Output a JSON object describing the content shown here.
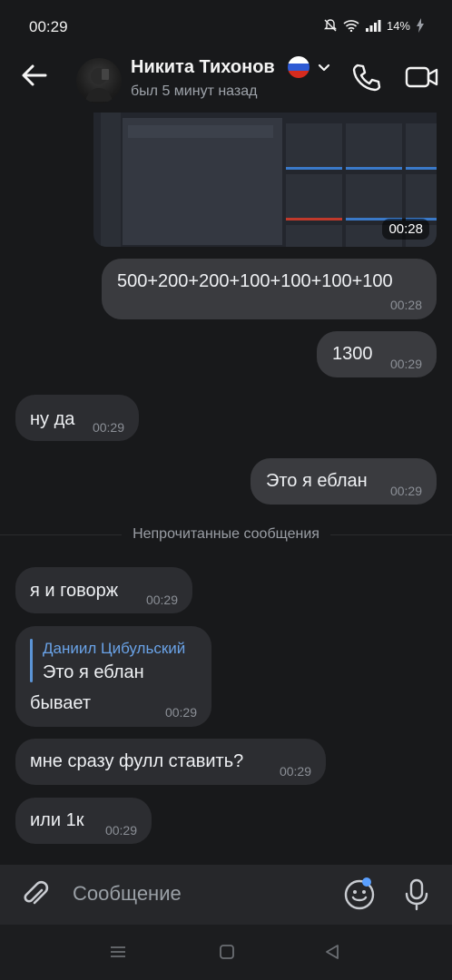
{
  "status_bar": {
    "time": "00:29",
    "battery": "14%"
  },
  "header": {
    "contact_name": "Никита Тихонов",
    "last_seen": "был 5 минут назад"
  },
  "photo": {
    "time": "00:28"
  },
  "messages": [
    {
      "direction": "out",
      "text": "500+200+200+100+100+100+100",
      "time": "00:28"
    },
    {
      "direction": "out",
      "text": "1300",
      "time": "00:29"
    },
    {
      "direction": "in",
      "text": "ну да",
      "time": "00:29"
    },
    {
      "direction": "out",
      "text": "Это я еблан",
      "time": "00:29"
    }
  ],
  "unread_label": "Непрочитанные сообщения",
  "unread_messages": [
    {
      "direction": "in",
      "text": "я и говорж",
      "time": "00:29"
    },
    {
      "direction": "in",
      "reply_author": "Даниил Цибульский",
      "reply_text": "Это я еблан",
      "text": "бывает",
      "time": "00:29"
    },
    {
      "direction": "in",
      "text": "мне сразу фулл ставить?",
      "time": "00:29"
    },
    {
      "direction": "in",
      "text": "или 1к",
      "time": "00:29"
    }
  ],
  "composer": {
    "placeholder": "Сообщение"
  },
  "colors": {
    "background": "#18191b",
    "outgoing": "#3a3b3f",
    "incoming": "#2c2d31",
    "accent": "#5b94d6"
  }
}
